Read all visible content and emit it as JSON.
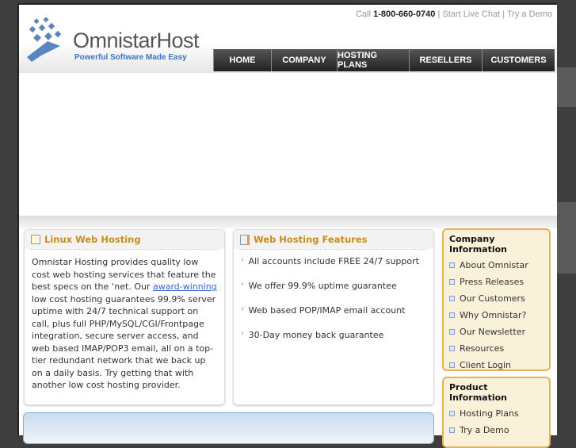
{
  "header": {
    "call_label": "Call",
    "phone": "1-800-660-0740",
    "sep": "|",
    "live_chat": "Start Live Chat",
    "demo": "Try a Demo"
  },
  "logo": {
    "name": "OmnistarHost",
    "tagline": "Powerful Software Made Easy"
  },
  "nav": [
    "HOME",
    "COMPANY",
    "HOSTING PLANS",
    "RESELLERS",
    "CUSTOMERS"
  ],
  "linux": {
    "title": "Linux Web Hosting",
    "text_before": "Omnistar Hosting provides quality low cost web hosting services that feature the best specs on the ‘net. Our ",
    "link": "award-winning",
    "text_after": " low cost hosting guarantees 99.9% server uptime with 24/7 technical support on call, plus full PHP/MySQL/CGI/Frontpage integration, secure server access, and web based IMAP/POP3 email, all on a top-tier redundant network that we back up on a daily basis. Try getting that with another low cost hosting provider."
  },
  "features": {
    "title": "Web Hosting Features",
    "items": [
      "All accounts include FREE 24/7 support",
      "We offer 99.9% uptime guarantee",
      "Web based POP/IMAP email account",
      "30-Day money back guarantee"
    ]
  },
  "company_info": {
    "title": "Company Information",
    "items": [
      "About Omnistar",
      "Press Releases",
      "Our Customers",
      "Why Omnistar?",
      "Our Newsletter",
      "Resources",
      "Client Login"
    ]
  },
  "product_info": {
    "title": "Product Information",
    "items": [
      "Hosting Plans",
      "Try a Demo"
    ]
  }
}
